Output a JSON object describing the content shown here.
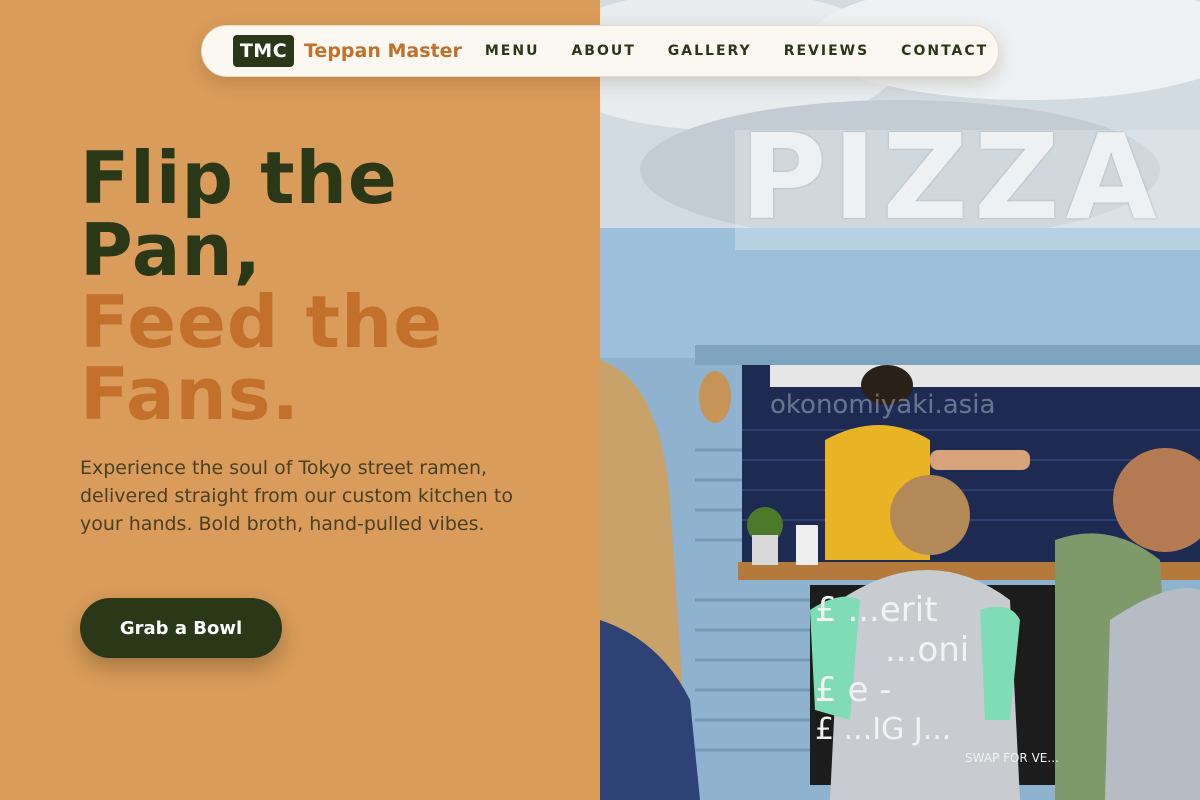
{
  "brand": {
    "badge": "TMC",
    "name": "Teppan Master"
  },
  "nav": {
    "links": [
      "MENU",
      "ABOUT",
      "GALLERY",
      "REVIEWS",
      "CONTACT"
    ]
  },
  "hero": {
    "title_line1": "Flip the",
    "title_line2": "Pan,",
    "title_line3": "Feed the",
    "title_line4": "Fans.",
    "description": "Experience the soul of Tokyo street ramen, delivered straight from our custom kitchen to your hands. Bold broth, hand-pulled vibes.",
    "cta_label": "Grab a Bowl"
  },
  "photo": {
    "sign_text": "PIZZA",
    "watermark": "okonomiyaki.asia",
    "chalkboard_lines": [
      "£ ...erit",
      "...oni",
      "£ e -",
      "£ ...IG J...",
      "SWAP FOR VE..."
    ]
  },
  "colors": {
    "background": "#d99c5a",
    "dark_green": "#2a3818",
    "accent_orange": "#c2702c",
    "nav_bg": "#fbf7f1",
    "body_text": "#4a3f22"
  }
}
